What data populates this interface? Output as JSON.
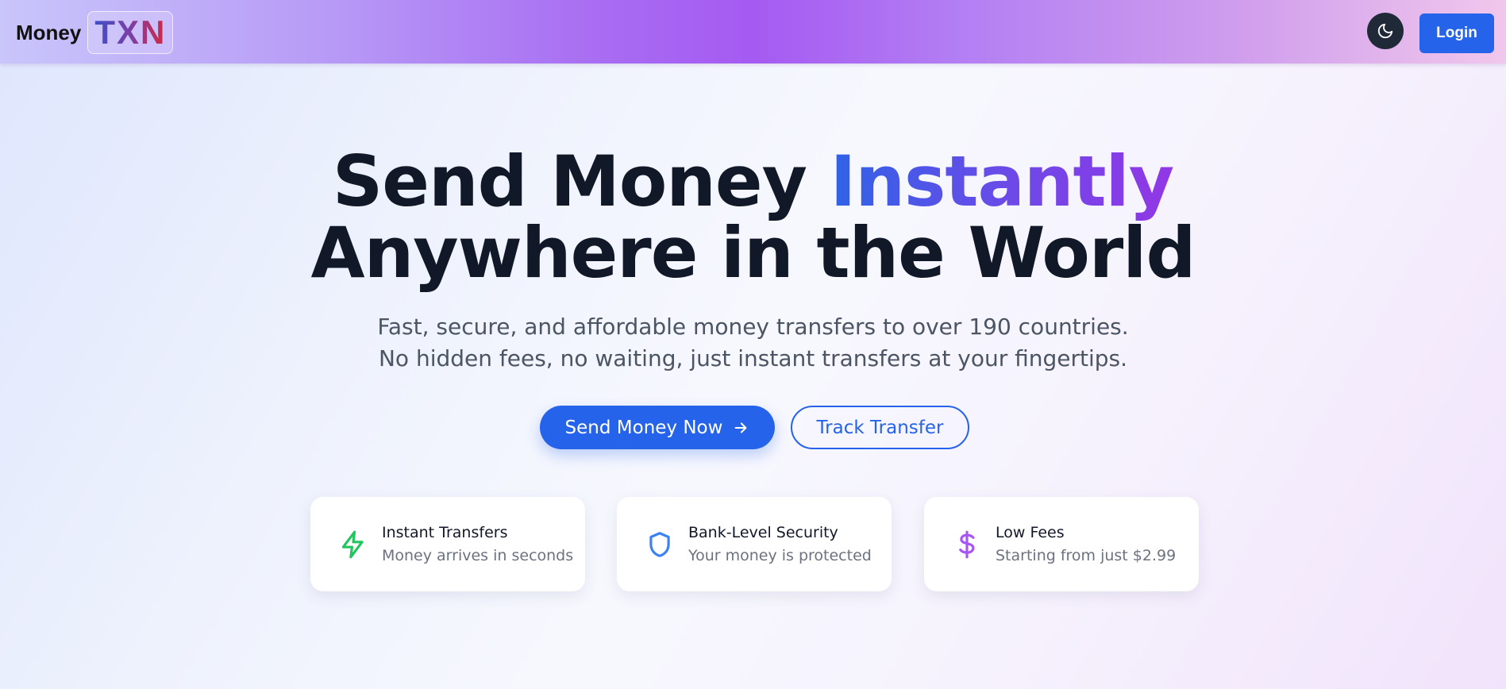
{
  "navbar": {
    "brand_word": "Money",
    "brand_badge": "TXN",
    "theme_icon": "moon-icon",
    "login_label": "Login"
  },
  "hero": {
    "title_line1_plain": "Send Money ",
    "title_line1_accent": "Instantly",
    "title_line2": "Anywhere in the World",
    "subtitle": "Fast, secure, and affordable money transfers to over 190 countries. No hidden fees, no waiting, just instant transfers at your fingertips.",
    "primary_cta": "Send Money Now",
    "primary_cta_icon": "arrow-right-icon",
    "secondary_cta": "Track Transfer"
  },
  "features": [
    {
      "title": "Instant Transfers",
      "desc": "Money arrives in seconds",
      "icon": "lightning-icon",
      "color": "#22c55e"
    },
    {
      "title": "Bank-Level Security",
      "desc": "Your money is protected",
      "icon": "shield-icon",
      "color": "#3b82f6"
    },
    {
      "title": "Low Fees",
      "desc": "Starting from just $2.99",
      "icon": "dollar-icon",
      "color": "#a855f7"
    }
  ],
  "colors": {
    "primary": "#2563eb",
    "text_dark": "#111827",
    "text_muted": "#4b5563"
  }
}
